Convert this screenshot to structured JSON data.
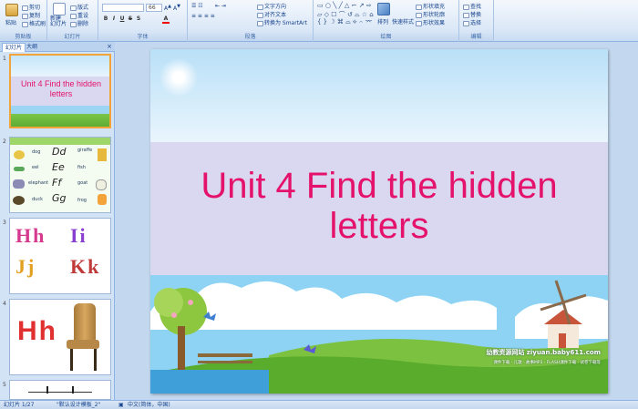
{
  "ribbon": {
    "groups": [
      {
        "label": "剪贴板"
      },
      {
        "label": "幻灯片"
      },
      {
        "label": "字体"
      },
      {
        "label": "段落"
      },
      {
        "label": "绘图"
      },
      {
        "label": "编辑"
      }
    ],
    "paste_label": "粘贴",
    "cut_label": "剪切",
    "copy_label": "复制",
    "format_painter_label": "格式刷",
    "new_slide_label": "新建\n幻灯片",
    "layout_label": "版式",
    "reset_label": "重设",
    "delete_label": "删除",
    "font_name": "",
    "font_size": "66",
    "text_direction_label": "文字方向",
    "align_text_label": "对齐文本",
    "smartart_label": "转换为 SmartArt",
    "arrange_label": "排列",
    "quick_styles_label": "快速样式",
    "shape_fill_label": "形状填充",
    "shape_outline_label": "形状轮廓",
    "shape_effects_label": "形状效果",
    "find_label": "查找",
    "replace_label": "替换",
    "select_label": "选择"
  },
  "left_pane": {
    "tab_slides": "幻灯片",
    "tab_outline": "大纲",
    "close": "×",
    "thumbs": [
      {
        "num": "1",
        "title": "Unit 4 Find the hidden letters"
      },
      {
        "num": "2",
        "rows": [
          {
            "word": "dog",
            "letters": "Dd",
            "word2": "giraffe"
          },
          {
            "word": "eel",
            "letters": "Ee",
            "word2": "fish"
          },
          {
            "word": "elephant",
            "letters": "Ff",
            "word2": "goat"
          },
          {
            "word": "duck",
            "letters": "Gg",
            "word2": "frog"
          }
        ]
      },
      {
        "num": "3",
        "pairs": [
          "Hh",
          "Ii",
          "Jj",
          "Kk"
        ]
      },
      {
        "num": "4",
        "letters": "Hh"
      },
      {
        "num": "5"
      }
    ]
  },
  "slide": {
    "title": "Unit 4 Find the hidden letters",
    "site_name": "幼教资源网站 ziyuan.baby611.com",
    "site_links": "课件下载 · 儿歌 · 故事MP3 · FLASH课件下载 · 试卷下载等"
  },
  "status": {
    "slide_count": "幻灯片 1/27",
    "theme": "\"默认设计模板_2\"",
    "language": "中文(简体，中国)"
  },
  "colors": {
    "title": "#e5126c",
    "band": "#d9d8f0",
    "selected_border": "#f2a43a"
  }
}
